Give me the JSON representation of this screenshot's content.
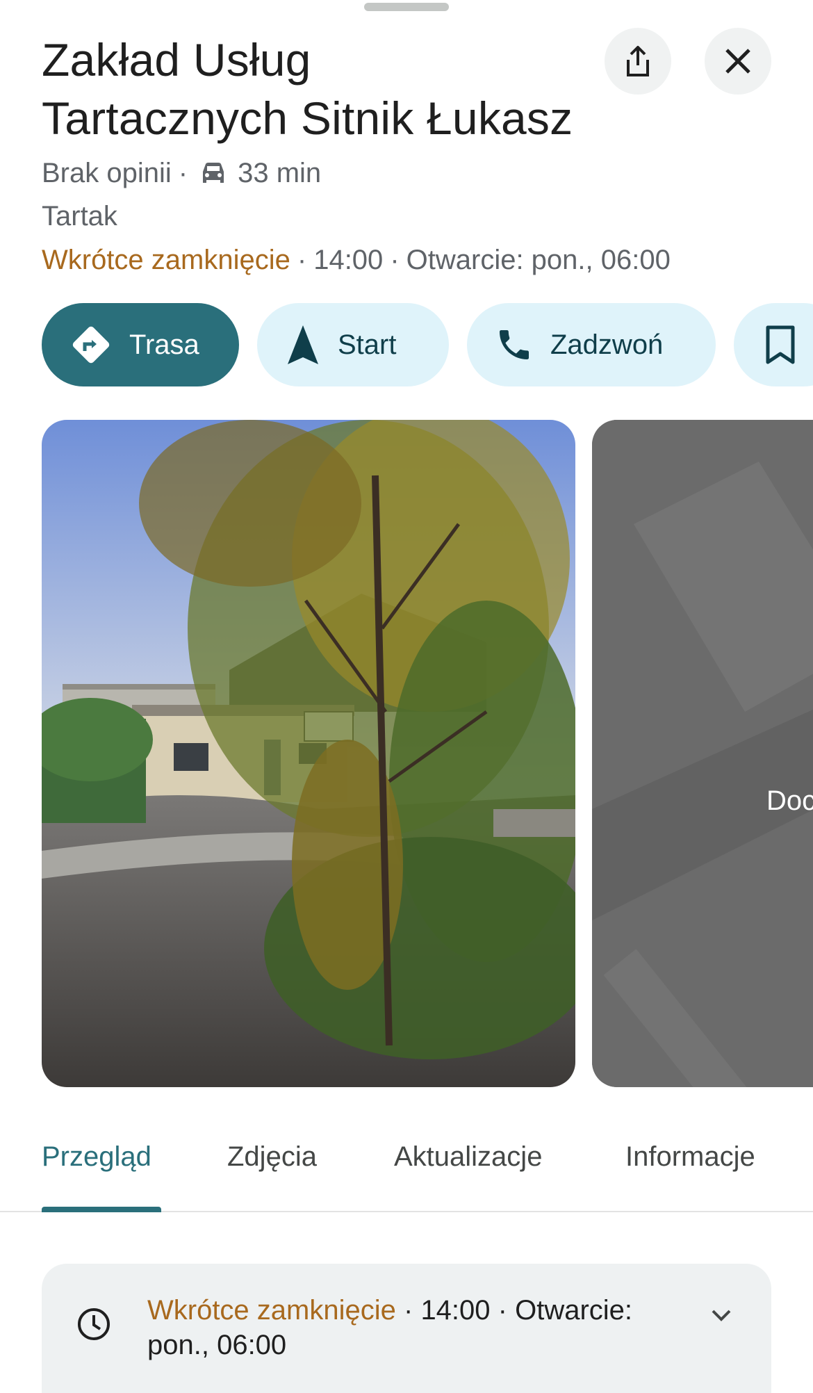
{
  "place": {
    "title_line1": "Zakład Usług",
    "title_line2": "Tartacznych Sitnik Łukasz",
    "reviews": "Brak opinii",
    "drive_time": "33 min",
    "category": "Tartak",
    "status": "Wkrótce zamknięcie",
    "closing_time": "14:00",
    "opening_info": "Otwarcie: pon., 06:00"
  },
  "actions": [
    {
      "label": "Trasa",
      "icon": "directions-icon"
    },
    {
      "label": "Start",
      "icon": "navigation-arrow-icon"
    },
    {
      "label": "Zadzwoń",
      "icon": "phone-icon"
    },
    {
      "label": "",
      "icon": "bookmark-icon"
    }
  ],
  "photos": {
    "side_label": "Doc"
  },
  "tabs": [
    {
      "label": "Przegląd",
      "active": true
    },
    {
      "label": "Zdjęcia",
      "active": false
    },
    {
      "label": "Aktualizacje",
      "active": false
    },
    {
      "label": "Informacje",
      "active": false
    }
  ],
  "hours_card": {
    "status": "Wkrótce zamknięcie",
    "closing_time": "14:00",
    "opening_label": "Otwarcie:",
    "opening_day_time": "pon., 06:00"
  },
  "colors": {
    "accent": "#2a6f7b",
    "status_orange": "#a8691e",
    "pill_bg": "#dff3fa"
  }
}
